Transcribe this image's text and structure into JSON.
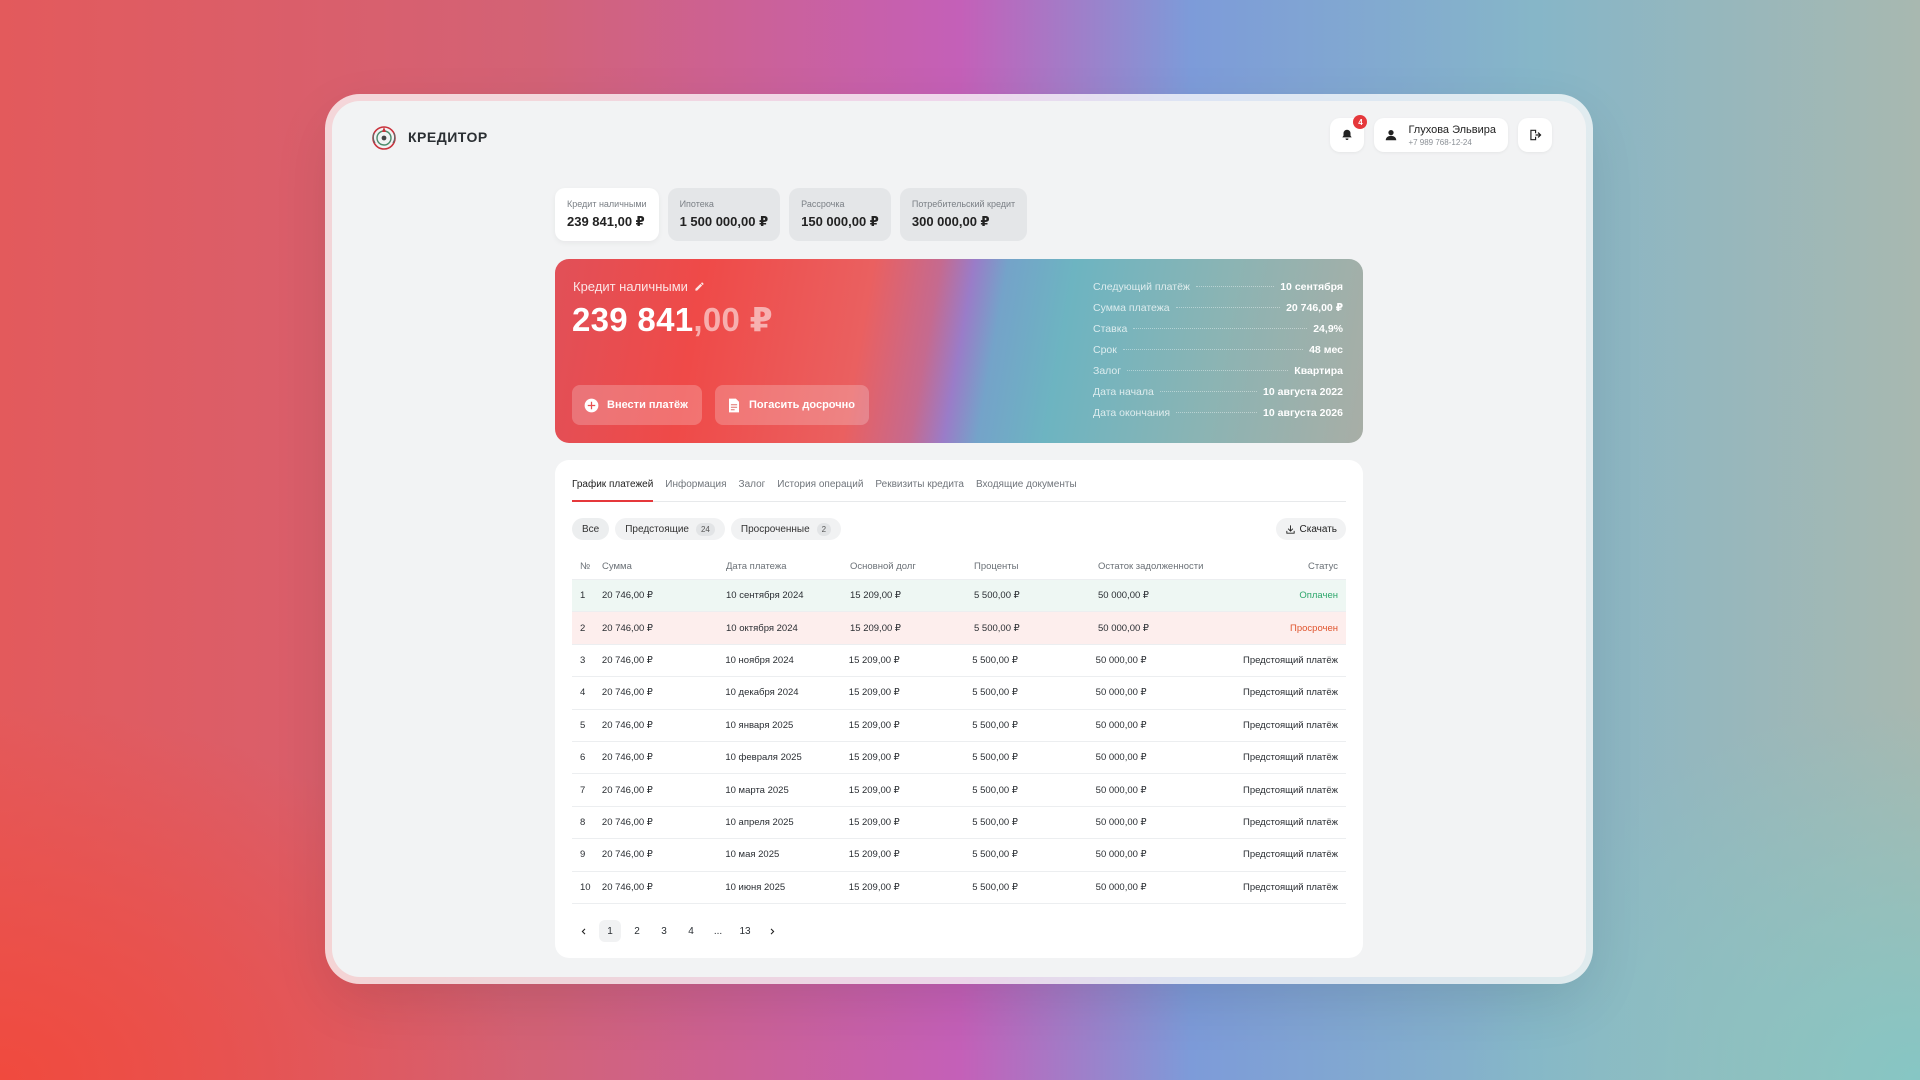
{
  "brand": {
    "name": "КРЕДИТОР"
  },
  "header": {
    "notifications_count": "4",
    "user_name": "Глухова Эльвира",
    "user_phone": "+7 989 768-12-24"
  },
  "loan_tabs": [
    {
      "label": "Кредит наличными",
      "amount": "239 841,00 ₽"
    },
    {
      "label": "Ипотека",
      "amount": "1 500 000,00 ₽"
    },
    {
      "label": "Рассрочка",
      "amount": "150 000,00 ₽"
    },
    {
      "label": "Потребительский кредит",
      "amount": "300 000,00 ₽"
    }
  ],
  "hero": {
    "title": "Кредит наличными",
    "amount_int": "239 841",
    "amount_frac": ",00 ₽",
    "pay_button": "Внести платёж",
    "early_button": "Погасить досрочно",
    "info": [
      {
        "label": "Следующий платёж",
        "value": "10 сентября"
      },
      {
        "label": "Сумма платежа",
        "value": "20 746,00 ₽"
      },
      {
        "label": "Ставка",
        "value": "24,9%"
      },
      {
        "label": "Срок",
        "value": "48 мес"
      },
      {
        "label": "Залог",
        "value": "Квартира"
      },
      {
        "label": "Дата начала",
        "value": "10 августа 2022"
      },
      {
        "label": "Дата окончания",
        "value": "10 августа 2026"
      }
    ]
  },
  "tabs": [
    "График платежей",
    "Информация",
    "Залог",
    "История операций",
    "Реквизиты кредита",
    "Входящие документы"
  ],
  "filters": {
    "all": "Все",
    "upcoming": "Предстоящие",
    "upcoming_count": "24",
    "overdue": "Просроченные",
    "overdue_count": "2",
    "download": "Скачать"
  },
  "table": {
    "headers": [
      "№",
      "Сумма",
      "Дата платежа",
      "Основной долг",
      "Проценты",
      "Остаток задолженности",
      "Статус"
    ],
    "rows": [
      [
        "1",
        "20 746,00 ₽",
        "10 сентября 2024",
        "15 209,00 ₽",
        "5 500,00 ₽",
        "50 000,00 ₽",
        "Оплачен"
      ],
      [
        "2",
        "20 746,00 ₽",
        "10 октября 2024",
        "15 209,00 ₽",
        "5 500,00 ₽",
        "50 000,00 ₽",
        "Просрочен"
      ],
      [
        "3",
        "20 746,00 ₽",
        "10 ноября 2024",
        "15 209,00 ₽",
        "5 500,00 ₽",
        "50 000,00 ₽",
        "Предстоящий платёж"
      ],
      [
        "4",
        "20 746,00 ₽",
        "10 декабря 2024",
        "15 209,00 ₽",
        "5 500,00 ₽",
        "50 000,00 ₽",
        "Предстоящий платёж"
      ],
      [
        "5",
        "20 746,00 ₽",
        "10 января 2025",
        "15 209,00 ₽",
        "5 500,00 ₽",
        "50 000,00 ₽",
        "Предстоящий платёж"
      ],
      [
        "6",
        "20 746,00 ₽",
        "10 февраля 2025",
        "15 209,00 ₽",
        "5 500,00 ₽",
        "50 000,00 ₽",
        "Предстоящий платёж"
      ],
      [
        "7",
        "20 746,00 ₽",
        "10 марта 2025",
        "15 209,00 ₽",
        "5 500,00 ₽",
        "50 000,00 ₽",
        "Предстоящий платёж"
      ],
      [
        "8",
        "20 746,00 ₽",
        "10 апреля 2025",
        "15 209,00 ₽",
        "5 500,00 ₽",
        "50 000,00 ₽",
        "Предстоящий платёж"
      ],
      [
        "9",
        "20 746,00 ₽",
        "10 мая 2025",
        "15 209,00 ₽",
        "5 500,00 ₽",
        "50 000,00 ₽",
        "Предстоящий платёж"
      ],
      [
        "10",
        "20 746,00 ₽",
        "10 июня 2025",
        "15 209,00 ₽",
        "5 500,00 ₽",
        "50 000,00 ₽",
        "Предстоящий платёж"
      ]
    ]
  },
  "pagination": [
    "1",
    "2",
    "3",
    "4",
    "...",
    "13"
  ],
  "colors": {
    "accent": "#e5383b",
    "paid": "#2fa86c",
    "overdue": "#e0552f"
  }
}
